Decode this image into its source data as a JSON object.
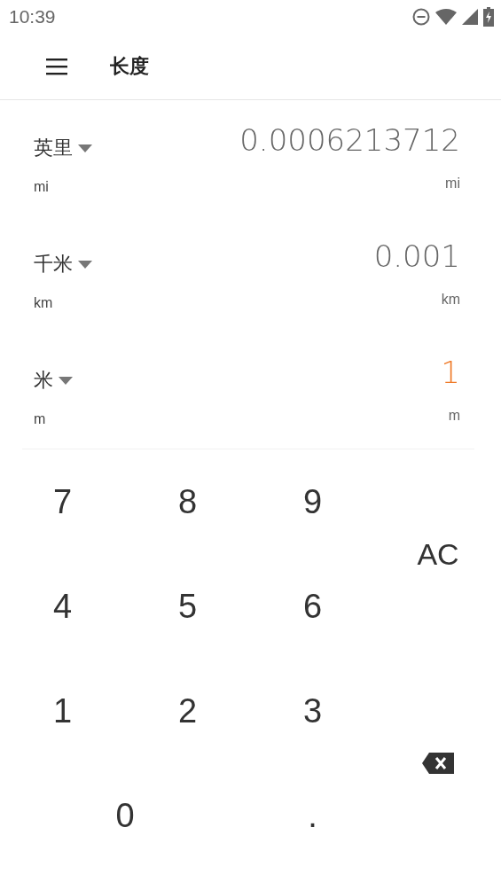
{
  "status_bar": {
    "time": "10:39"
  },
  "app_bar": {
    "title": "长度"
  },
  "units": [
    {
      "name": "英里",
      "abbr": "mi",
      "value": "0.0006213712",
      "value_abbr": "mi",
      "selected": false
    },
    {
      "name": "千米",
      "abbr": "km",
      "value": "0.001",
      "value_abbr": "km",
      "selected": false
    },
    {
      "name": "米",
      "abbr": "m",
      "value": "1",
      "value_abbr": "m",
      "selected": true
    }
  ],
  "keypad": [
    {
      "kind": "digit",
      "label": "7"
    },
    {
      "kind": "digit",
      "label": "8"
    },
    {
      "kind": "digit",
      "label": "9"
    },
    {
      "kind": "clear",
      "label": "AC"
    },
    {
      "kind": "digit",
      "label": "4"
    },
    {
      "kind": "digit",
      "label": "5"
    },
    {
      "kind": "digit",
      "label": "6"
    },
    {
      "kind": "digit",
      "label": "1"
    },
    {
      "kind": "digit",
      "label": "2"
    },
    {
      "kind": "digit",
      "label": "3"
    },
    {
      "kind": "backspace"
    },
    {
      "kind": "wide",
      "label": "0"
    },
    {
      "kind": "digit",
      "label": "."
    }
  ]
}
